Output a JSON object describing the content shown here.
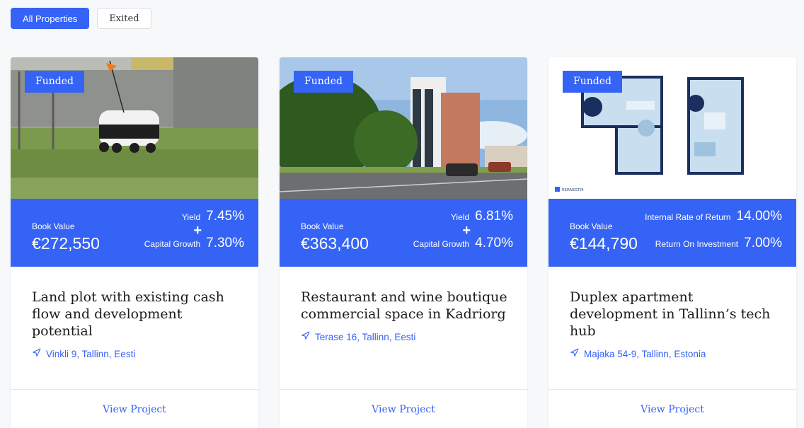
{
  "filters": {
    "all_label": "All Properties",
    "exited_label": "Exited"
  },
  "colors": {
    "accent": "#3563f5"
  },
  "cards": [
    {
      "badge": "Funded",
      "book_value_label": "Book Value",
      "book_value": "€272,550",
      "stat1_label": "Yield",
      "stat1_value": "7.45%",
      "plus": "+",
      "stat2_label": "Capital Growth",
      "stat2_value": "7.30%",
      "title": "Land plot with existing cash flow and development potential",
      "location": "Vinkli 9, Tallinn, Eesti",
      "cta": "View Project"
    },
    {
      "badge": "Funded",
      "book_value_label": "Book Value",
      "book_value": "€363,400",
      "stat1_label": "Yield",
      "stat1_value": "6.81%",
      "plus": "+",
      "stat2_label": "Capital Growth",
      "stat2_value": "4.70%",
      "title": "Restaurant and wine boutique commercial space in Kadriorg",
      "location": "Terase 16, Tallinn, Eesti",
      "cta": "View Project"
    },
    {
      "badge": "Funded",
      "book_value_label": "Book Value",
      "book_value": "€144,790",
      "stat1_label": "Internal Rate of Return",
      "stat1_value": "14.00%",
      "stat2_label": "Return On Investment",
      "stat2_value": "7.00%",
      "title": "Duplex apartment development in Tallinn’s tech hub",
      "location": "Majaka 54-9, Tallinn, Estonia",
      "cta": "View Project",
      "logo_text": "REINVEST24"
    }
  ]
}
